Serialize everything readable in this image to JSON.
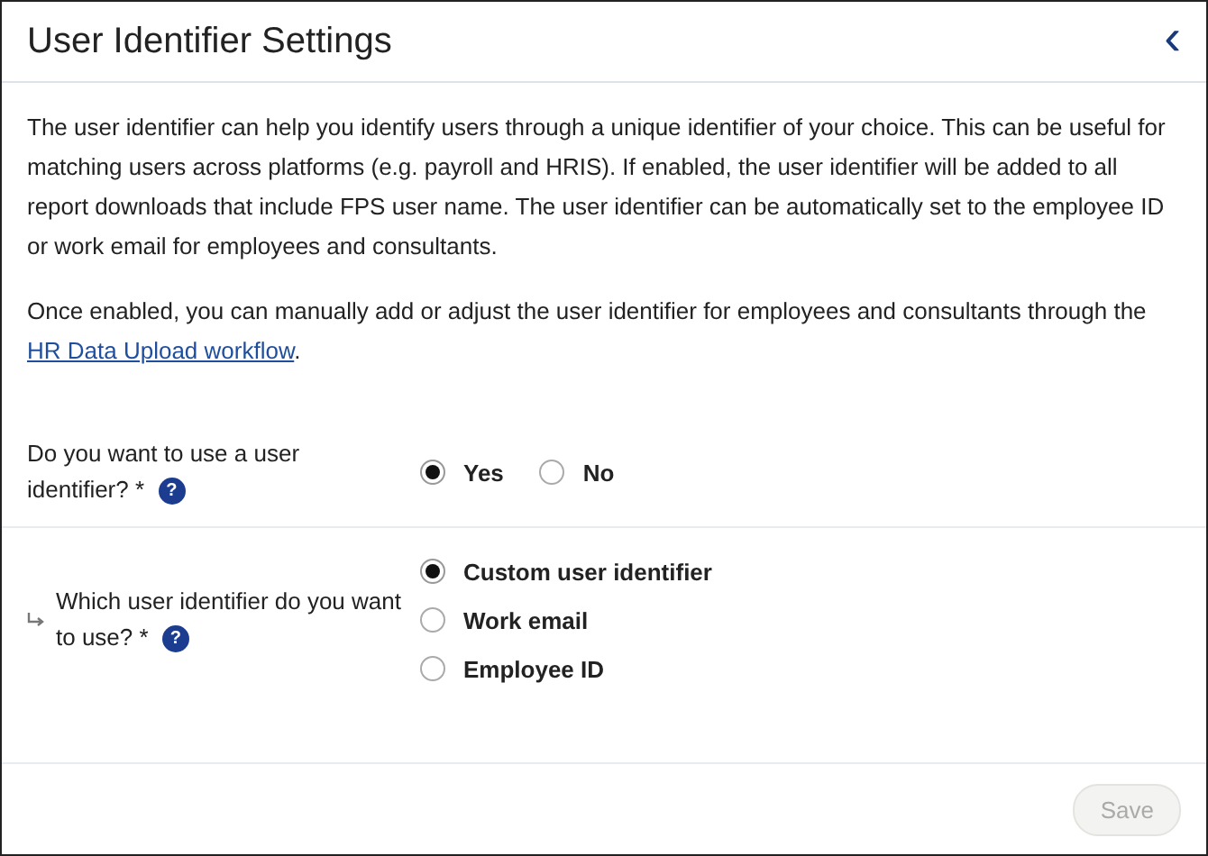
{
  "header": {
    "title": "User Identifier Settings",
    "back": "‹"
  },
  "intro": "The user identifier can help you identify users through a unique identifier of your choice. This can be useful for matching users across platforms (e.g. payroll and HRIS). If enabled, the user identifier will be added to all report downloads that include FPS user name. The user identifier can be automatically set to the employee ID or work email for employees and consultants.",
  "note": {
    "before": "Once enabled, you can manually add or adjust the user identifier for employees and consultants through the ",
    "link": "HR Data Upload workflow",
    "after": "."
  },
  "questions": [
    {
      "label": "Do you want to use a user identifier? *",
      "help": "?",
      "nested": false,
      "kind": "inline",
      "options": [
        {
          "label": "Yes",
          "selected": true
        },
        {
          "label": "No",
          "selected": false
        }
      ]
    },
    {
      "label": "Which user identifier do you want to use? *",
      "help": "?",
      "nested": true,
      "kind": "stacked",
      "options": [
        {
          "label": "Custom user identifier",
          "selected": true
        },
        {
          "label": "Work email",
          "selected": false
        },
        {
          "label": "Employee ID",
          "selected": false
        }
      ]
    }
  ],
  "footer": {
    "save": {
      "label": "Save",
      "disabled": true
    }
  }
}
